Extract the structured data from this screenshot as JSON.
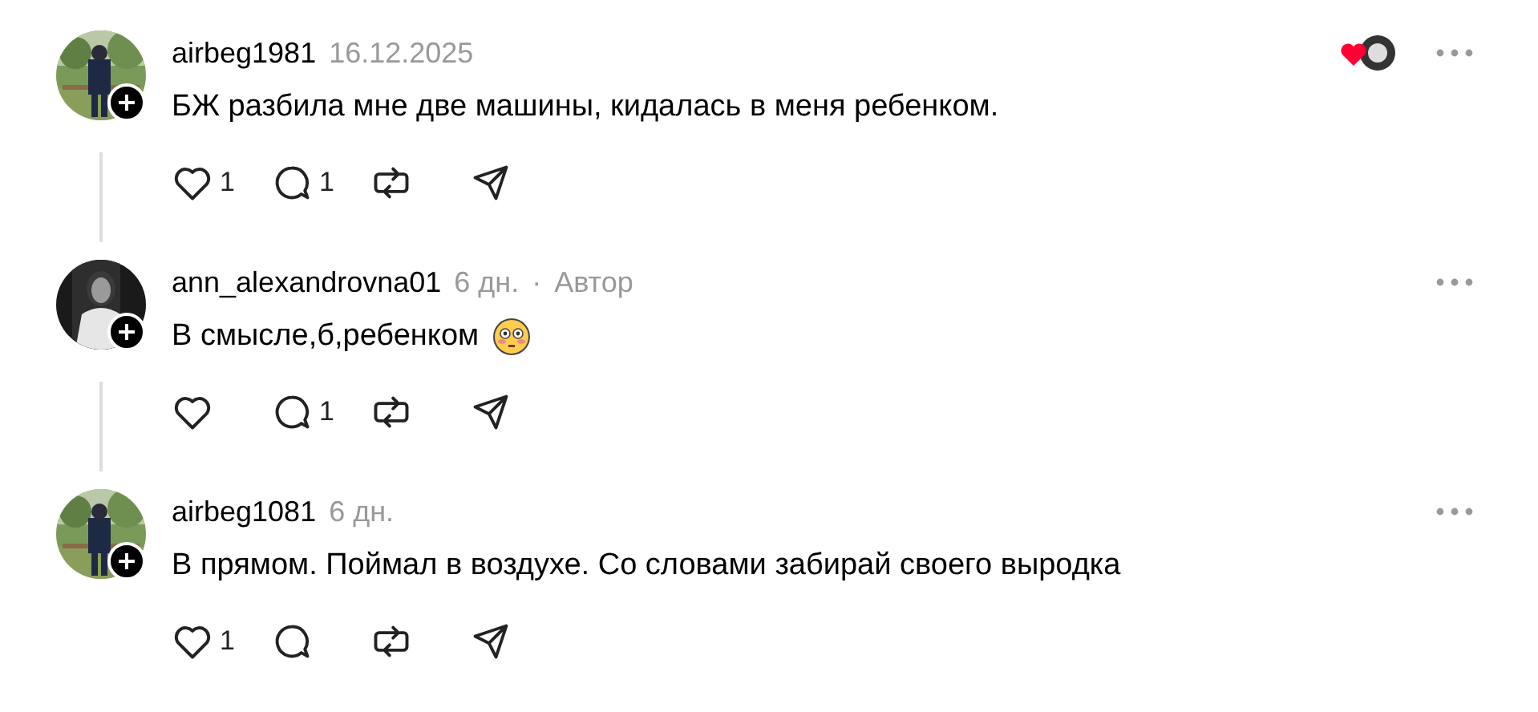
{
  "comments": [
    {
      "username": "airbeg1981",
      "time": "16.12.2025",
      "text": "БЖ разбила мне две машины, кидалась в меня ребенком.",
      "emoji": false,
      "liked_by_author": true,
      "thread_line": true,
      "actions": {
        "likes": "1",
        "replies": "1"
      }
    },
    {
      "username": "ann_alexandrovna01",
      "time": "6 дн.",
      "separator": "·",
      "author_tag": "Автор",
      "text": "В смысле,б,ребенком",
      "emoji": true,
      "liked_by_author": false,
      "thread_line": true,
      "actions": {
        "replies": "1"
      }
    },
    {
      "username": "airbeg1081",
      "time": "6 дн.",
      "text": "В прямом. Поймал в воздухе. Со словами забирай своего выродка",
      "emoji": false,
      "liked_by_author": false,
      "thread_line": false,
      "actions": {
        "likes": "1"
      }
    }
  ]
}
